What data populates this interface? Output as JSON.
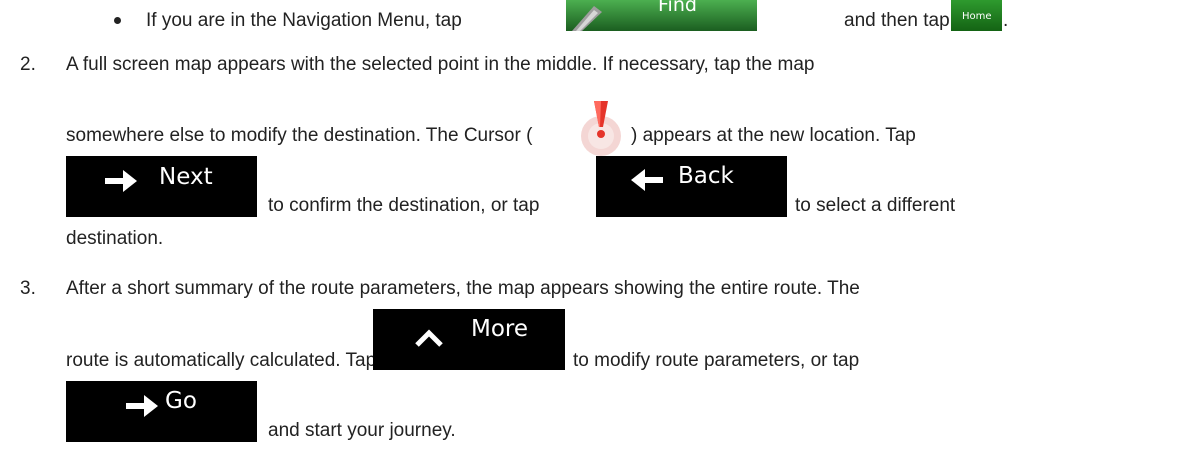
{
  "step1": {
    "bullet_text_a": "If you are in the Navigation Menu, tap",
    "find_button_label": "Find",
    "bullet_text_b": "and then tap",
    "home_button_label": "Home",
    "end_period": "."
  },
  "step2": {
    "number": "2.",
    "line1": "A full screen map appears with the selected point in the middle. If necessary, tap the map",
    "line2a": "somewhere else to modify the destination. The Cursor (",
    "line2b": ") appears at the new location. Tap",
    "next_button_label": "Next",
    "line3a": "to confirm the destination, or tap",
    "back_button_label": "Back",
    "line3b": "to select a different",
    "line4": "destination."
  },
  "step3": {
    "number": "3.",
    "line1": "After a short summary of the route parameters, the map appears showing the entire route. The",
    "line2a": "route is automatically calculated. Tap",
    "more_button_label": "More",
    "line2b": "to modify route parameters, or tap",
    "go_button_label": "Go",
    "line3": "and start your journey."
  },
  "colors": {
    "button_bg": "#000000",
    "find_button_bg": "#2e7d32",
    "home_button_bg": "#1b7a1b",
    "cursor_red": "#e5342a"
  }
}
